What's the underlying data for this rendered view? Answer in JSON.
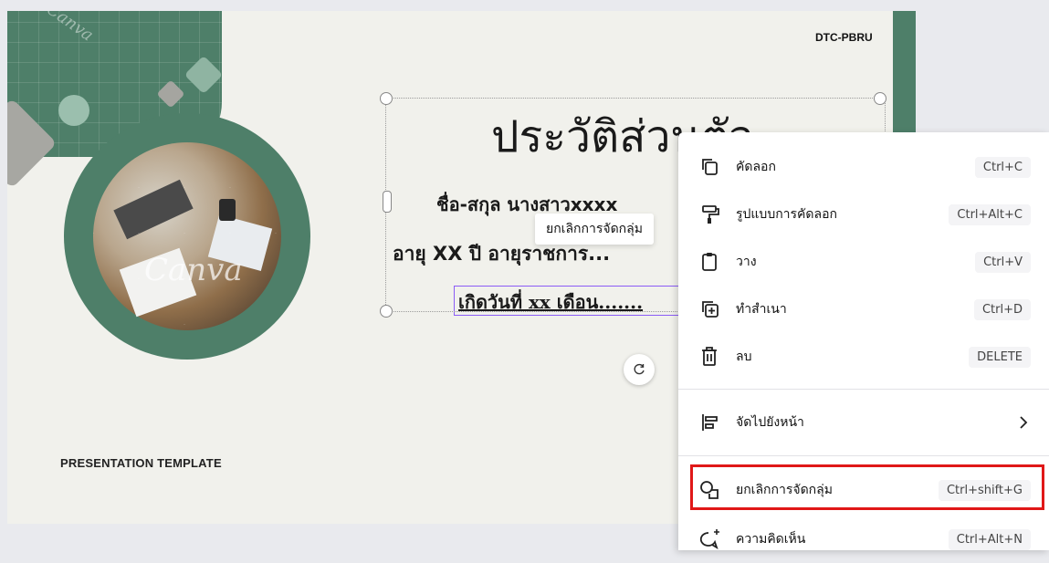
{
  "slide": {
    "brand": "DTC-PBRU",
    "title": "ประวัติส่วนตัว",
    "name_line": "ชื่อ-สกุล นางสาวxxxx",
    "age_line": "อายุ XX ปี อายุราชการ...",
    "born_line": "เกิดวันที่ xx เดือน.......",
    "footer": "PRESENTATION TEMPLATE",
    "watermark": "Canva",
    "tooltip": "ยกเลิกการจัดกลุ่ม"
  },
  "context_menu": {
    "items": [
      {
        "label": "คัดลอก",
        "shortcut": "Ctrl+C",
        "icon": "copy-icon"
      },
      {
        "label": "รูปแบบการคัดลอก",
        "shortcut": "Ctrl+Alt+C",
        "icon": "paint-roller-icon"
      },
      {
        "label": "วาง",
        "shortcut": "Ctrl+V",
        "icon": "clipboard-icon"
      },
      {
        "label": "ทำสำเนา",
        "shortcut": "Ctrl+D",
        "icon": "duplicate-icon"
      },
      {
        "label": "ลบ",
        "shortcut": "DELETE",
        "icon": "trash-icon"
      },
      {
        "label": "จัดไปยังหน้า",
        "shortcut": "",
        "icon": "align-icon"
      },
      {
        "label": "ยกเลิกการจัดกลุ่ม",
        "shortcut": "Ctrl+shift+G",
        "icon": "ungroup-icon"
      },
      {
        "label": "ความคิดเห็น",
        "shortcut": "Ctrl+Alt+N",
        "icon": "comment-icon"
      }
    ],
    "highlight_color": "#e01818"
  },
  "colors": {
    "accent_green": "#4e7f69",
    "selection_purple": "#8b5cf6"
  }
}
